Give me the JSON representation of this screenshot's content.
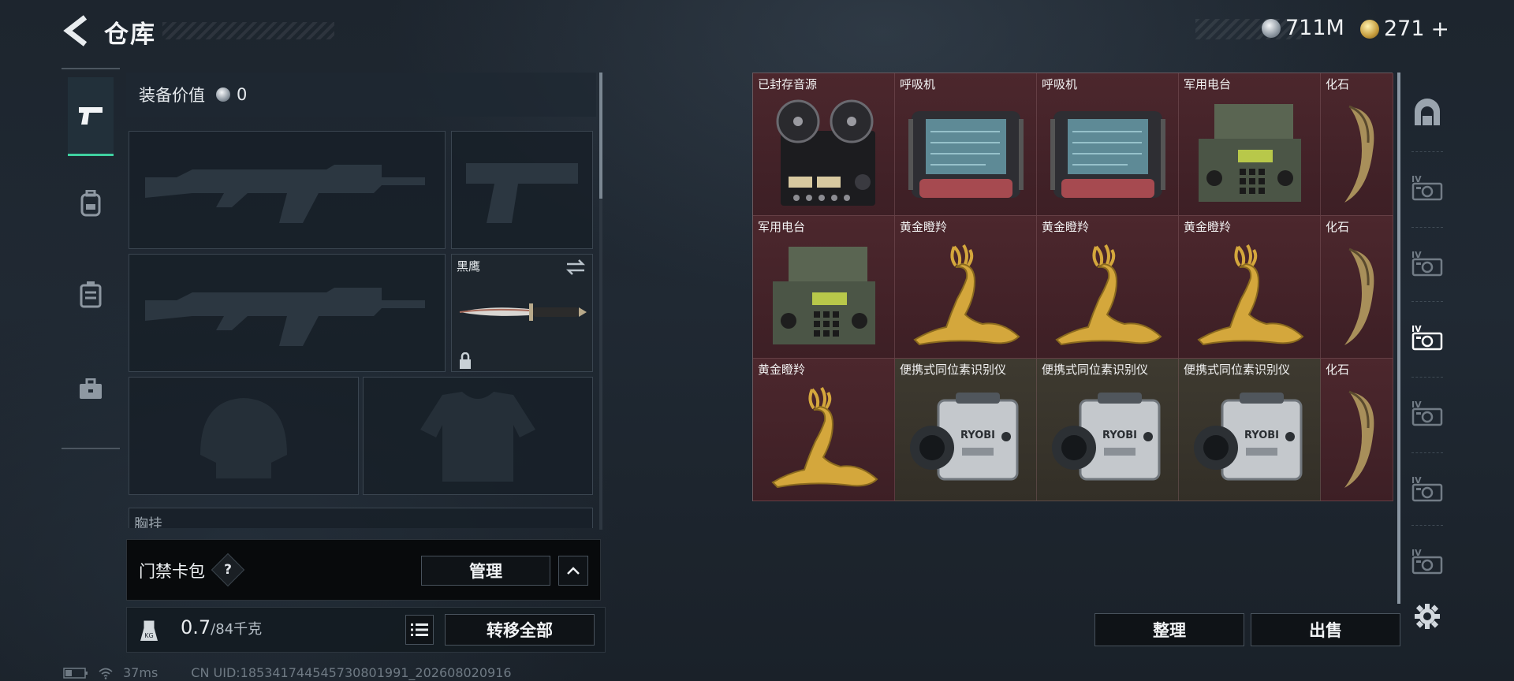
{
  "header": {
    "title": "仓库",
    "currency_silver": "711M",
    "currency_gold": "271",
    "add_label": "+"
  },
  "equipment": {
    "value_label": "装备价值",
    "value": "0",
    "knife_name": "黑鹰",
    "chest_label": "胸挂"
  },
  "card_bag": {
    "label": "门禁卡包",
    "help": "?",
    "manage_label": "管理"
  },
  "weight": {
    "current": "0.7",
    "max": "/84千克",
    "transfer_label": "转移全部"
  },
  "status": {
    "latency": "37ms",
    "uid": "CN UID:185341744545730801991_202608020916"
  },
  "storage": {
    "items": [
      {
        "name": "已封存音源",
        "icon": "tape-recorder-icon",
        "bg": "red"
      },
      {
        "name": "呼吸机",
        "icon": "ventilator-icon",
        "bg": "red"
      },
      {
        "name": "呼吸机",
        "icon": "ventilator-icon",
        "bg": "red"
      },
      {
        "name": "军用电台",
        "icon": "military-radio-icon",
        "bg": "red"
      },
      {
        "name": "化石",
        "icon": "fossil-claw-icon",
        "bg": "red"
      },
      {
        "name": "军用电台",
        "icon": "military-radio-icon",
        "bg": "red"
      },
      {
        "name": "黄金瞪羚",
        "icon": "golden-gazelle-icon",
        "bg": "red"
      },
      {
        "name": "黄金瞪羚",
        "icon": "golden-gazelle-icon",
        "bg": "red"
      },
      {
        "name": "黄金瞪羚",
        "icon": "golden-gazelle-icon",
        "bg": "red"
      },
      {
        "name": "化石",
        "icon": "fossil-claw-icon",
        "bg": "red"
      },
      {
        "name": "黄金瞪羚",
        "icon": "golden-gazelle-icon",
        "bg": "red"
      },
      {
        "name": "便携式同位素识别仪",
        "icon": "isotope-scanner-icon",
        "bg": "olive"
      },
      {
        "name": "便携式同位素识别仪",
        "icon": "isotope-scanner-icon",
        "bg": "olive"
      },
      {
        "name": "便携式同位素识别仪",
        "icon": "isotope-scanner-icon",
        "bg": "olive"
      },
      {
        "name": "化石",
        "icon": "fossil-claw-icon",
        "bg": "red"
      }
    ],
    "arrange_label": "整理",
    "sell_label": "出售"
  },
  "colors": {
    "accent": "#3fd0a0",
    "item_red": "#4c272d",
    "item_olive": "#3e3a30"
  }
}
